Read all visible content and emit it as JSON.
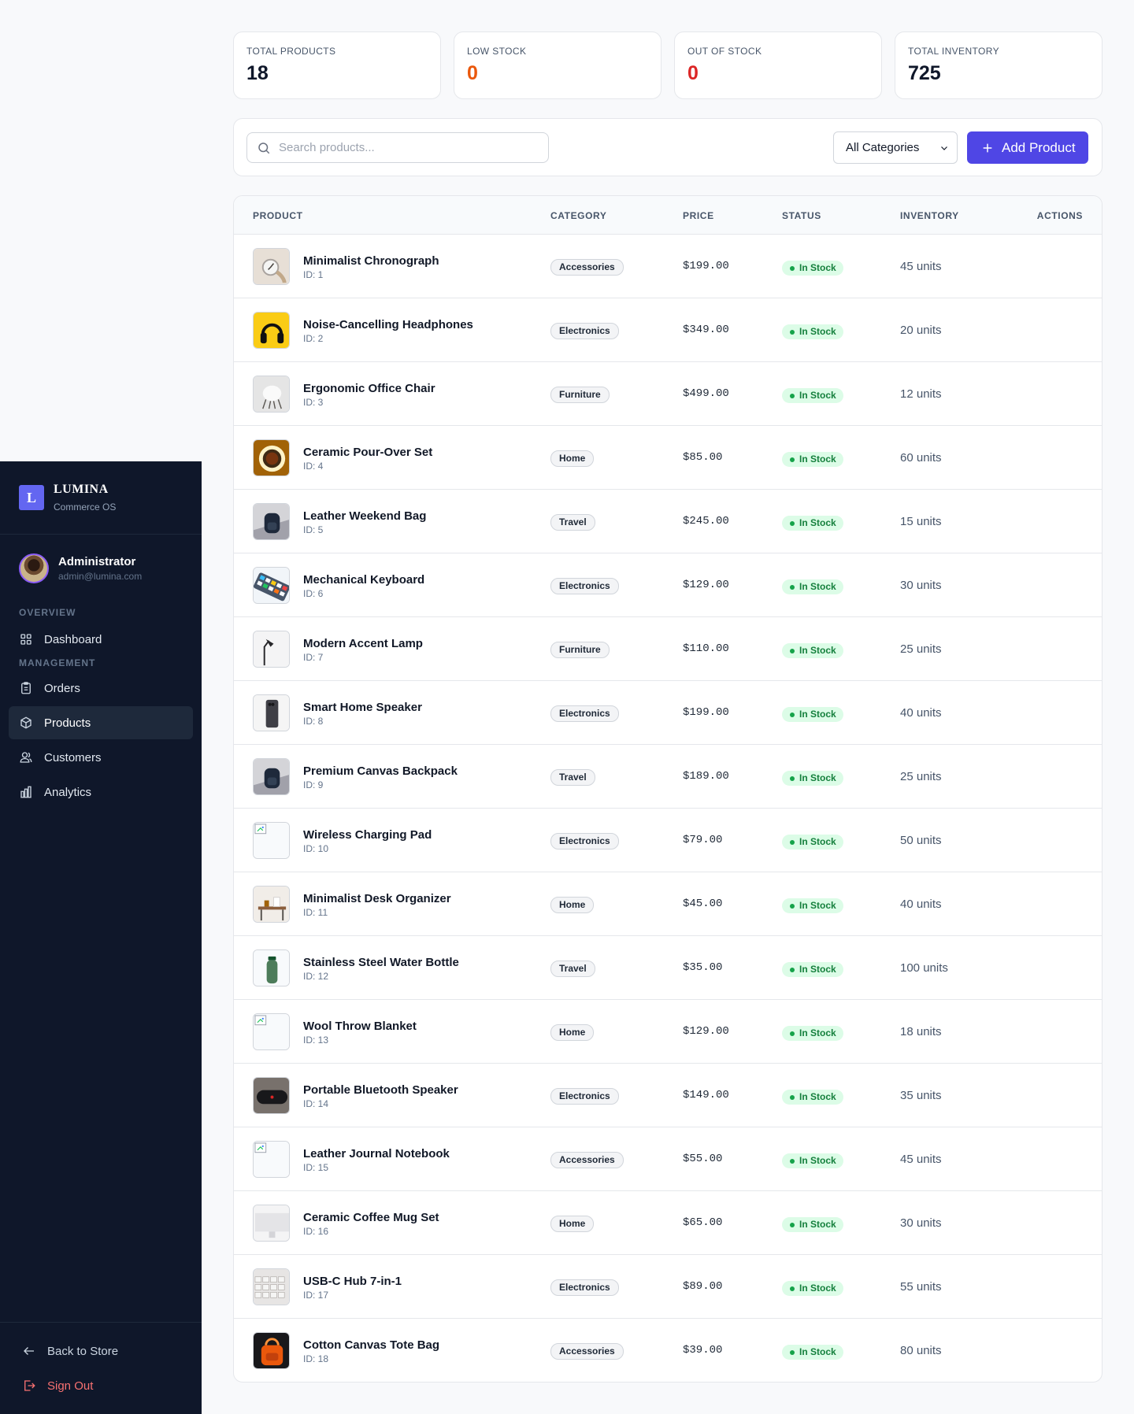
{
  "brand": {
    "logo_letter": "L",
    "name": "LUMINA",
    "subtitle": "Commerce OS"
  },
  "user": {
    "name": "Administrator",
    "email": "admin@lumina.com"
  },
  "nav": {
    "section_overview": "OVERVIEW",
    "section_management": "MANAGEMENT",
    "dashboard": "Dashboard",
    "orders": "Orders",
    "products": "Products",
    "customers": "Customers",
    "analytics": "Analytics",
    "back": "Back to Store",
    "signout": "Sign Out"
  },
  "stats": [
    {
      "label": "TOTAL PRODUCTS",
      "value": "18",
      "color": "#0f172a"
    },
    {
      "label": "LOW STOCK",
      "value": "0",
      "color": "#ea580c"
    },
    {
      "label": "OUT OF STOCK",
      "value": "0",
      "color": "#dc2626"
    },
    {
      "label": "TOTAL INVENTORY",
      "value": "725",
      "color": "#0f172a"
    }
  ],
  "toolbar": {
    "search_placeholder": "Search products...",
    "category_selected": "All Categories",
    "add_label": "Add Product"
  },
  "table": {
    "headers": {
      "product": "PRODUCT",
      "category": "CATEGORY",
      "price": "PRICE",
      "status": "STATUS",
      "inventory": "INVENTORY",
      "actions": "ACTIONS"
    },
    "rows": [
      {
        "name": "Minimalist Chronograph",
        "id": "ID: 1",
        "category": "Accessories",
        "price": "$199.00",
        "status": "In Stock",
        "inventory": "45 units",
        "thumb": "watch"
      },
      {
        "name": "Noise-Cancelling Headphones",
        "id": "ID: 2",
        "category": "Electronics",
        "price": "$349.00",
        "status": "In Stock",
        "inventory": "20 units",
        "thumb": "headphones"
      },
      {
        "name": "Ergonomic Office Chair",
        "id": "ID: 3",
        "category": "Furniture",
        "price": "$499.00",
        "status": "In Stock",
        "inventory": "12 units",
        "thumb": "chair"
      },
      {
        "name": "Ceramic Pour-Over Set",
        "id": "ID: 4",
        "category": "Home",
        "price": "$85.00",
        "status": "In Stock",
        "inventory": "60 units",
        "thumb": "coffee"
      },
      {
        "name": "Leather Weekend Bag",
        "id": "ID: 5",
        "category": "Travel",
        "price": "$245.00",
        "status": "In Stock",
        "inventory": "15 units",
        "thumb": "backpack"
      },
      {
        "name": "Mechanical Keyboard",
        "id": "ID: 6",
        "category": "Electronics",
        "price": "$129.00",
        "status": "In Stock",
        "inventory": "30 units",
        "thumb": "keyboard"
      },
      {
        "name": "Modern Accent Lamp",
        "id": "ID: 7",
        "category": "Furniture",
        "price": "$110.00",
        "status": "In Stock",
        "inventory": "25 units",
        "thumb": "lamp"
      },
      {
        "name": "Smart Home Speaker",
        "id": "ID: 8",
        "category": "Electronics",
        "price": "$199.00",
        "status": "In Stock",
        "inventory": "40 units",
        "thumb": "phone"
      },
      {
        "name": "Premium Canvas Backpack",
        "id": "ID: 9",
        "category": "Travel",
        "price": "$189.00",
        "status": "In Stock",
        "inventory": "25 units",
        "thumb": "backpack"
      },
      {
        "name": "Wireless Charging Pad",
        "id": "ID: 10",
        "category": "Electronics",
        "price": "$79.00",
        "status": "In Stock",
        "inventory": "50 units",
        "thumb": "broken"
      },
      {
        "name": "Minimalist Desk Organizer",
        "id": "ID: 11",
        "category": "Home",
        "price": "$45.00",
        "status": "In Stock",
        "inventory": "40 units",
        "thumb": "desk"
      },
      {
        "name": "Stainless Steel Water Bottle",
        "id": "ID: 12",
        "category": "Travel",
        "price": "$35.00",
        "status": "In Stock",
        "inventory": "100 units",
        "thumb": "bottle"
      },
      {
        "name": "Wool Throw Blanket",
        "id": "ID: 13",
        "category": "Home",
        "price": "$129.00",
        "status": "In Stock",
        "inventory": "18 units",
        "thumb": "broken"
      },
      {
        "name": "Portable Bluetooth Speaker",
        "id": "ID: 14",
        "category": "Electronics",
        "price": "$149.00",
        "status": "In Stock",
        "inventory": "35 units",
        "thumb": "speaker"
      },
      {
        "name": "Leather Journal Notebook",
        "id": "ID: 15",
        "category": "Accessories",
        "price": "$55.00",
        "status": "In Stock",
        "inventory": "45 units",
        "thumb": "broken"
      },
      {
        "name": "Ceramic Coffee Mug Set",
        "id": "ID: 16",
        "category": "Home",
        "price": "$65.00",
        "status": "In Stock",
        "inventory": "30 units",
        "thumb": "imac"
      },
      {
        "name": "USB-C Hub 7-in-1",
        "id": "ID: 17",
        "category": "Electronics",
        "price": "$89.00",
        "status": "In Stock",
        "inventory": "55 units",
        "thumb": "keys"
      },
      {
        "name": "Cotton Canvas Tote Bag",
        "id": "ID: 18",
        "category": "Accessories",
        "price": "$39.00",
        "status": "In Stock",
        "inventory": "80 units",
        "thumb": "tote"
      }
    ]
  }
}
